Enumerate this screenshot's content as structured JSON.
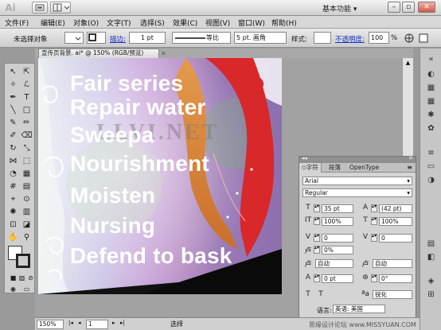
{
  "app": {
    "logo": "Ai",
    "workspace": "基本功能"
  },
  "window_controls": {
    "minimize": "–",
    "restore": "▫",
    "close": "✕"
  },
  "menu": [
    "文件(F)",
    "编辑(E)",
    "对象(O)",
    "文字(T)",
    "选择(S)",
    "效果(C)",
    "视图(V)",
    "窗口(W)",
    "帮助(H)"
  ],
  "control_bar": {
    "selection": "未选择对象",
    "stroke_label": "描边:",
    "stroke_weight": "1 pt",
    "stroke_profile": "等比",
    "brush": "5 pt. 画角",
    "style_label": "样式:",
    "opacity_label": "不透明度:",
    "opacity_value": "100",
    "opacity_unit": "%"
  },
  "document_tab": {
    "title": "宣传页背景. ai* @ 150% (RGB/预览)",
    "close": "✕"
  },
  "artwork": {
    "watermark": "LLVI.NET",
    "lines": [
      "Fair series",
      "Repair water",
      "Sweepa",
      "Nourishment",
      "Moisten",
      "Nursing",
      "Defend to bask"
    ]
  },
  "character_panel": {
    "tabs": [
      "◇字符",
      "段落",
      "OpenType"
    ],
    "font_family": "Arial",
    "font_style": "Regular",
    "font_size": "35 pt",
    "leading": "(42 pt)",
    "vertical_scale": "100%",
    "horizontal_scale": "100%",
    "kerning": "0",
    "tracking": "0",
    "tsume": "0%",
    "aki_left": "自动",
    "aki_right": "自动",
    "baseline_shift": "0 pt",
    "rotation": "0°",
    "antialias": "锐化",
    "language_label": "语言:",
    "language": "英语: 美国"
  },
  "status_bar": {
    "zoom": "150%",
    "page": "1",
    "tool": "选择"
  },
  "site_watermark": "思缘设计论坛 www.MISSYUAN.COM"
}
